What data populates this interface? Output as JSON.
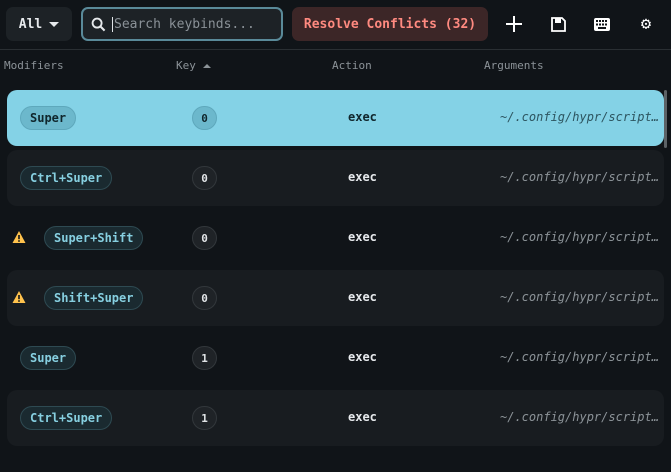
{
  "toolbar": {
    "filter": "All",
    "search_placeholder": "Search keybinds...",
    "search_value": "",
    "resolve": "Resolve Conflicts (32)"
  },
  "headers": {
    "modifiers": "Modifiers",
    "key": "Key",
    "action": "Action",
    "arguments": "Arguments"
  },
  "rows": [
    {
      "modifiers": "Super",
      "key": "0",
      "action": "exec",
      "args": "~/.config/hypr/scripts…",
      "conflict": false,
      "selected": true
    },
    {
      "modifiers": "Ctrl+Super",
      "key": "0",
      "action": "exec",
      "args": "~/.config/hypr/scripts…",
      "conflict": false
    },
    {
      "modifiers": "Super+Shift",
      "key": "0",
      "action": "exec",
      "args": "~/.config/hypr/scripts…",
      "conflict": true
    },
    {
      "modifiers": "Shift+Super",
      "key": "0",
      "action": "exec",
      "args": "~/.config/hypr/scripts…",
      "conflict": true
    },
    {
      "modifiers": "Super",
      "key": "1",
      "action": "exec",
      "args": "~/.config/hypr/scripts…",
      "conflict": false
    },
    {
      "modifiers": "Ctrl+Super",
      "key": "1",
      "action": "exec",
      "args": "~/.config/hypr/scripts…",
      "conflict": false
    }
  ],
  "colors": {
    "accent": "#84d2e6",
    "conflict": "#ff8a80",
    "warning": "#ffc24d"
  }
}
